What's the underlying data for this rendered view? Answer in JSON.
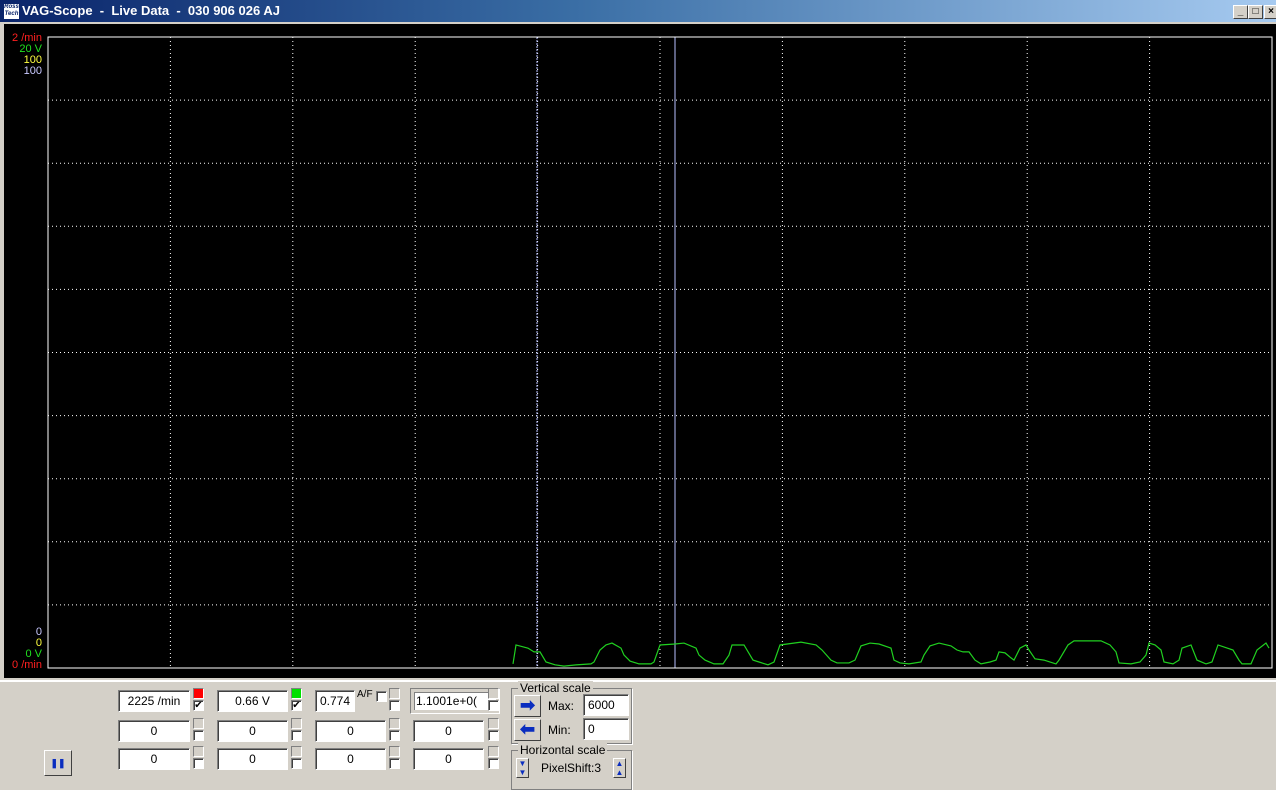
{
  "window": {
    "title": "VAG-Scope  -  Live Data  -  030 906 026 AJ",
    "logo_text": "Ross Tech",
    "minimize": "_",
    "maximize": "□",
    "close": "×"
  },
  "scale_labels": {
    "top": [
      {
        "text": "2 /min",
        "color": "#ff2020"
      },
      {
        "text": "20 V",
        "color": "#20e020"
      },
      {
        "text": "100",
        "color": "#ffff40"
      },
      {
        "text": "100",
        "color": "#c8c8ff"
      }
    ],
    "bottom": [
      {
        "text": "0",
        "color": "#c8c8ff"
      },
      {
        "text": "0",
        "color": "#ffff40"
      },
      {
        "text": "0 V",
        "color": "#20e020"
      },
      {
        "text": "0 /min",
        "color": "#ff2020"
      }
    ]
  },
  "chart_data": {
    "type": "line",
    "x_range": [
      0,
      408
    ],
    "y_range": [
      0,
      20
    ],
    "y_unit": "V",
    "grid": {
      "x_divisions": 10,
      "y_divisions": 10
    },
    "cursors": [
      163,
      209
    ],
    "series": [
      {
        "name": "0.66 V",
        "color": "#20d020",
        "points": [
          [
            155,
            0.13
          ],
          [
            156,
            0.73
          ],
          [
            160,
            0.63
          ],
          [
            162,
            0.51
          ],
          [
            164,
            0.51
          ],
          [
            166,
            0.19
          ],
          [
            169,
            0.1
          ],
          [
            172,
            0.06
          ],
          [
            176,
            0.1
          ],
          [
            181,
            0.13
          ],
          [
            182,
            0.19
          ],
          [
            184,
            0.57
          ],
          [
            186,
            0.73
          ],
          [
            188,
            0.79
          ],
          [
            191,
            0.63
          ],
          [
            192,
            0.41
          ],
          [
            194,
            0.22
          ],
          [
            197,
            0.13
          ],
          [
            201,
            0.13
          ],
          [
            202,
            0.19
          ],
          [
            204,
            0.73
          ],
          [
            209,
            0.76
          ],
          [
            212,
            0.79
          ],
          [
            216,
            0.63
          ],
          [
            217,
            0.41
          ],
          [
            219,
            0.25
          ],
          [
            222,
            0.13
          ],
          [
            225,
            0.13
          ],
          [
            227,
            0.41
          ],
          [
            228,
            0.73
          ],
          [
            232,
            0.73
          ],
          [
            234,
            0.41
          ],
          [
            235,
            0.25
          ],
          [
            237,
            0.19
          ],
          [
            240,
            0.1
          ],
          [
            242,
            0.19
          ],
          [
            244,
            0.73
          ],
          [
            251,
            0.82
          ],
          [
            256,
            0.73
          ],
          [
            258,
            0.57
          ],
          [
            261,
            0.25
          ],
          [
            263,
            0.16
          ],
          [
            267,
            0.16
          ],
          [
            269,
            0.25
          ],
          [
            271,
            0.7
          ],
          [
            274,
            0.79
          ],
          [
            277,
            0.76
          ],
          [
            281,
            0.63
          ],
          [
            282,
            0.25
          ],
          [
            284,
            0.16
          ],
          [
            287,
            0.13
          ],
          [
            291,
            0.19
          ],
          [
            292,
            0.41
          ],
          [
            294,
            0.7
          ],
          [
            297,
            0.79
          ],
          [
            301,
            0.7
          ],
          [
            303,
            0.57
          ],
          [
            305,
            0.51
          ],
          [
            307,
            0.51
          ],
          [
            309,
            0.25
          ],
          [
            311,
            0.13
          ],
          [
            314,
            0.19
          ],
          [
            316,
            0.25
          ],
          [
            317,
            0.51
          ],
          [
            319,
            0.48
          ],
          [
            321,
            0.32
          ],
          [
            322,
            0.25
          ],
          [
            324,
            0.63
          ],
          [
            326,
            0.73
          ],
          [
            327,
            0.57
          ],
          [
            329,
            0.29
          ],
          [
            332,
            0.25
          ],
          [
            336,
            0.13
          ],
          [
            337,
            0.25
          ],
          [
            340,
            0.73
          ],
          [
            342,
            0.86
          ],
          [
            351,
            0.86
          ],
          [
            354,
            0.73
          ],
          [
            356,
            0.51
          ],
          [
            357,
            0.16
          ],
          [
            361,
            0.13
          ],
          [
            364,
            0.19
          ],
          [
            366,
            0.41
          ],
          [
            367,
            0.79
          ],
          [
            369,
            0.73
          ],
          [
            371,
            0.57
          ],
          [
            372,
            0.19
          ],
          [
            375,
            0.13
          ],
          [
            377,
            0.25
          ],
          [
            378,
            0.63
          ],
          [
            381,
            0.73
          ],
          [
            383,
            0.25
          ],
          [
            386,
            0.13
          ],
          [
            388,
            0.19
          ],
          [
            390,
            0.73
          ],
          [
            395,
            0.57
          ],
          [
            397,
            0.25
          ],
          [
            398,
            0.13
          ],
          [
            401,
            0.13
          ],
          [
            403,
            0.57
          ],
          [
            406,
            0.79
          ],
          [
            407,
            0.63
          ]
        ]
      }
    ]
  },
  "channels": {
    "row1": [
      "2225 /min",
      "0.66 V",
      "0.774",
      "1.1001e+0("
    ],
    "row2": [
      "0",
      "0",
      "0",
      "0"
    ],
    "row3": [
      "0",
      "0",
      "0",
      "0"
    ],
    "af_label": "A/F",
    "check": "✔",
    "colors": [
      "#ff0000",
      "#00e000"
    ]
  },
  "vertical_scale": {
    "title": "Vertical scale",
    "max_label": "Max:",
    "max_value": "6000",
    "min_label": "Min:",
    "min_value": "0"
  },
  "horizontal_scale": {
    "title": "Horizontal scale",
    "value": "PixelShift:3"
  },
  "pause_icon": "❚❚"
}
